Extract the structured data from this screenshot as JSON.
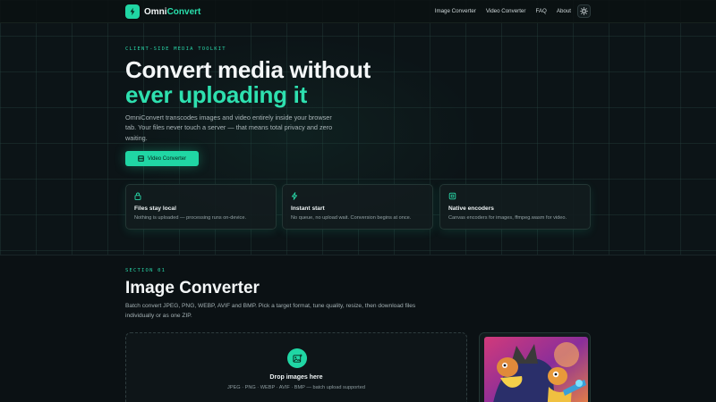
{
  "nav": {
    "logo_prefix": "Omni",
    "logo_accent": "Convert",
    "links": [
      "Image Converter",
      "Video Converter",
      "FAQ",
      "About"
    ],
    "theme_icon": "sun-icon"
  },
  "hero": {
    "eyebrow": "CLIENT-SIDE MEDIA TOOLKIT",
    "title_line1": "Convert media without",
    "title_line2": "ever uploading it",
    "lead": "OmniConvert transcodes images and video entirely inside your browser tab. Your files never touch a server — that means total privacy and zero waiting.",
    "cta_label": "Video Converter",
    "cta_icon": "film-icon"
  },
  "features": [
    {
      "icon": "lock-icon",
      "title": "Files stay local",
      "desc": "Nothing is uploaded — processing runs on-device."
    },
    {
      "icon": "bolt-icon",
      "title": "Instant start",
      "desc": "No queue, no upload wait. Conversion begins at once."
    },
    {
      "icon": "chip-icon",
      "title": "Native encoders",
      "desc": "Canvas encoders for images, ffmpeg.wasm for video."
    }
  ],
  "section": {
    "eyebrow": "SECTION 01",
    "title": "Image Converter",
    "desc": "Batch convert JPEG, PNG, WEBP, AVIF and BMP. Pick a target format, tune quality, resize, then download files individually or as one ZIP.",
    "drop_title": "Drop images here",
    "drop_sub": "JPEG · PNG · WEBP · AVIF · BMP — batch upload supported",
    "drop_icon": "image-plus-icon"
  },
  "colors": {
    "accent": "#20d6a4",
    "background": "#0b1114"
  }
}
